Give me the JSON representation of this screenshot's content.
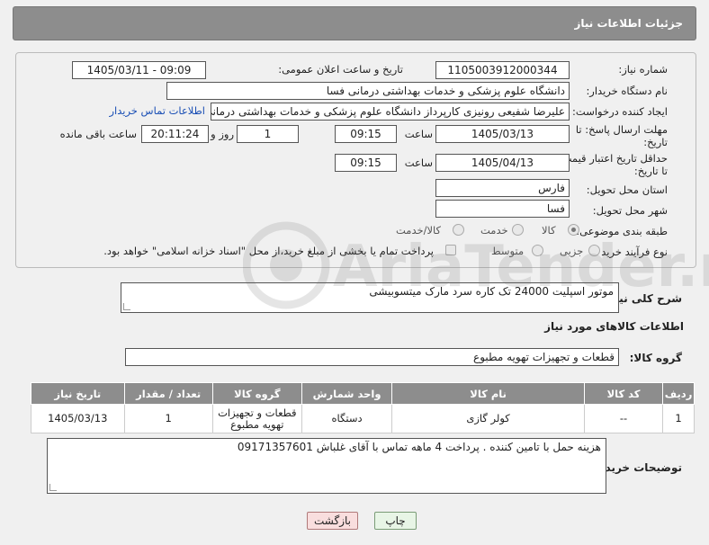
{
  "header": {
    "title": "جزئیات اطلاعات نیاز"
  },
  "fields": {
    "need_number_label": "شماره نیاز:",
    "need_number": "1105003912000344",
    "announce_label": "تاریخ و ساعت اعلان عمومی:",
    "announce_value": "1405/03/11 - 09:09",
    "buyer_org_label": "نام دستگاه خریدار:",
    "buyer_org": "دانشگاه علوم پزشکی و خدمات بهداشتی درمانی فسا",
    "requester_label": "ایجاد کننده درخواست:",
    "requester": "علیرضا شفیعی رونیزی کارپرداز دانشگاه علوم پزشکی و خدمات بهداشتی درمانی فسا",
    "contact_link": "اطلاعات تماس خریدار",
    "deadline_label_1": "مهلت ارسال پاسخ: تا",
    "deadline_label_2": "تاریخ:",
    "deadline_date": "1405/03/13",
    "time_label": "ساعت",
    "deadline_time": "09:15",
    "days_value": "1",
    "days_label": "روز و",
    "remaining_time": "20:11:24",
    "remaining_label": "ساعت باقی مانده",
    "price_valid_label_1": "حداقل تاریخ اعتبار قیمت:",
    "price_valid_label_2": "تا تاریخ:",
    "price_valid_date": "1405/04/13",
    "price_valid_time": "09:15",
    "province_label": "استان محل تحویل:",
    "province": "فارس",
    "city_label": "شهر محل تحویل:",
    "city": "فسا",
    "category_label": "طبقه بندی موضوعی:",
    "category_options": [
      "کالا",
      "خدمت",
      "کالا/خدمت"
    ],
    "process_label": "نوع فرآیند خرید :",
    "process_options": [
      "جزیی",
      "متوسط"
    ],
    "payment_note": "پرداخت تمام یا بخشی از مبلغ خرید،از محل \"اسناد خزانه اسلامی\" خواهد بود."
  },
  "summary": {
    "label": "شرح کلی نیاز:",
    "text": "موتور اسپلیت 24000 تک کاره سرد مارک میتسوبیشی"
  },
  "goods": {
    "section_title": "اطلاعات کالاهای مورد نیاز",
    "group_label": "گروه کالا:",
    "group_value": "قطعات و تجهیزات تهویه مطبوع",
    "columns": [
      "ردیف",
      "کد کالا",
      "نام کالا",
      "واحد شمارش",
      "گروه کالا",
      "تعداد / مقدار",
      "تاریخ نیاز"
    ],
    "rows": [
      {
        "row": "1",
        "code": "--",
        "name": "کولر گازی",
        "unit": "دستگاه",
        "group": "قطعات و تجهیزات تهویه مطبوع",
        "qty": "1",
        "date": "1405/03/13"
      }
    ]
  },
  "buyer_notes": {
    "label": "توضیحات خریدار:",
    "text": "هزینه حمل با تامین کننده . پرداخت 4 ماهه تماس با آقای غلباش 09171357601"
  },
  "buttons": {
    "print": "چاپ",
    "back": "بازگشت"
  },
  "watermark": {
    "text": "AriaTender.neT"
  }
}
